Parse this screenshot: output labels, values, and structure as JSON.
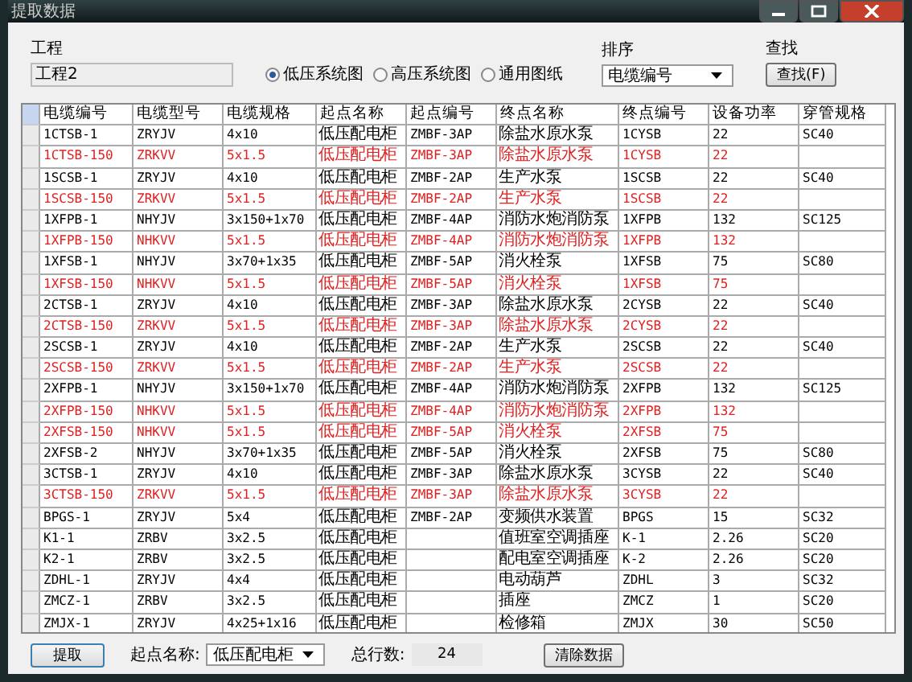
{
  "window": {
    "title": "提取数据"
  },
  "project": {
    "label": "工程",
    "value": "工程2"
  },
  "system_options": [
    {
      "label": "低压系统图",
      "selected": true
    },
    {
      "label": "高压系统图",
      "selected": false
    },
    {
      "label": "通用图纸",
      "selected": false
    }
  ],
  "sort": {
    "label": "排序",
    "value": "电缆编号"
  },
  "find": {
    "label": "查找",
    "button": "查找(F)"
  },
  "table": {
    "columns": [
      "电缆编号",
      "电缆型号",
      "电缆规格",
      "起点名称",
      "起点编号",
      "终点名称",
      "终点编号",
      "设备功率",
      "穿管规格"
    ],
    "rows": [
      {
        "highlighted": false,
        "cells": [
          "1CTSB-1",
          "ZRYJV",
          "4x10",
          "低压配电柜",
          "ZMBF-3AP",
          "除盐水原水泵",
          "1CYSB",
          "22",
          "SC40"
        ]
      },
      {
        "highlighted": true,
        "cells": [
          "1CTSB-150",
          "ZRKVV",
          "5x1.5",
          "低压配电柜",
          "ZMBF-3AP",
          "除盐水原水泵",
          "1CYSB",
          "22",
          ""
        ]
      },
      {
        "highlighted": false,
        "cells": [
          "1SCSB-1",
          "ZRYJV",
          "4x10",
          "低压配电柜",
          "ZMBF-2AP",
          "生产水泵",
          "1SCSB",
          "22",
          "SC40"
        ]
      },
      {
        "highlighted": true,
        "cells": [
          "1SCSB-150",
          "ZRKVV",
          "5x1.5",
          "低压配电柜",
          "ZMBF-2AP",
          "生产水泵",
          "1SCSB",
          "22",
          ""
        ]
      },
      {
        "highlighted": false,
        "cells": [
          "1XFPB-1",
          "NHYJV",
          "3x150+1x70",
          "低压配电柜",
          "ZMBF-4AP",
          "消防水炮消防泵",
          "1XFPB",
          "132",
          "SC125"
        ]
      },
      {
        "highlighted": true,
        "cells": [
          "1XFPB-150",
          "NHKVV",
          "5x1.5",
          "低压配电柜",
          "ZMBF-4AP",
          "消防水炮消防泵",
          "1XFPB",
          "132",
          ""
        ]
      },
      {
        "highlighted": false,
        "cells": [
          "1XFSB-1",
          "NHYJV",
          "3x70+1x35",
          "低压配电柜",
          "ZMBF-5AP",
          "消火栓泵",
          "1XFSB",
          "75",
          "SC80"
        ]
      },
      {
        "highlighted": true,
        "cells": [
          "1XFSB-150",
          "NHKVV",
          "5x1.5",
          "低压配电柜",
          "ZMBF-5AP",
          "消火栓泵",
          "1XFSB",
          "75",
          ""
        ]
      },
      {
        "highlighted": false,
        "cells": [
          "2CTSB-1",
          "ZRYJV",
          "4x10",
          "低压配电柜",
          "ZMBF-3AP",
          "除盐水原水泵",
          "2CYSB",
          "22",
          "SC40"
        ]
      },
      {
        "highlighted": true,
        "cells": [
          "2CTSB-150",
          "ZRKVV",
          "5x1.5",
          "低压配电柜",
          "ZMBF-3AP",
          "除盐水原水泵",
          "2CYSB",
          "22",
          ""
        ]
      },
      {
        "highlighted": false,
        "cells": [
          "2SCSB-1",
          "ZRYJV",
          "4x10",
          "低压配电柜",
          "ZMBF-2AP",
          "生产水泵",
          "2SCSB",
          "22",
          "SC40"
        ]
      },
      {
        "highlighted": true,
        "cells": [
          "2SCSB-150",
          "ZRKVV",
          "5x1.5",
          "低压配电柜",
          "ZMBF-2AP",
          "生产水泵",
          "2SCSB",
          "22",
          ""
        ]
      },
      {
        "highlighted": false,
        "cells": [
          "2XFPB-1",
          "NHYJV",
          "3x150+1x70",
          "低压配电柜",
          "ZMBF-4AP",
          "消防水炮消防泵",
          "2XFPB",
          "132",
          "SC125"
        ]
      },
      {
        "highlighted": true,
        "cells": [
          "2XFPB-150",
          "NHKVV",
          "5x1.5",
          "低压配电柜",
          "ZMBF-4AP",
          "消防水炮消防泵",
          "2XFPB",
          "132",
          ""
        ]
      },
      {
        "highlighted": true,
        "cells": [
          "2XFSB-150",
          "NHKVV",
          "5x1.5",
          "低压配电柜",
          "ZMBF-5AP",
          "消火栓泵",
          "2XFSB",
          "75",
          ""
        ]
      },
      {
        "highlighted": false,
        "cells": [
          "2XFSB-2",
          "NHYJV",
          "3x70+1x35",
          "低压配电柜",
          "ZMBF-5AP",
          "消火栓泵",
          "2XFSB",
          "75",
          "SC80"
        ]
      },
      {
        "highlighted": false,
        "cells": [
          "3CTSB-1",
          "ZRYJV",
          "4x10",
          "低压配电柜",
          "ZMBF-3AP",
          "除盐水原水泵",
          "3CYSB",
          "22",
          "SC40"
        ]
      },
      {
        "highlighted": true,
        "cells": [
          "3CTSB-150",
          "ZRKVV",
          "5x1.5",
          "低压配电柜",
          "ZMBF-3AP",
          "除盐水原水泵",
          "3CYSB",
          "22",
          ""
        ]
      },
      {
        "highlighted": false,
        "cells": [
          "BPGS-1",
          "ZRYJV",
          "5x4",
          "低压配电柜",
          "ZMBF-2AP",
          "变频供水装置",
          "BPGS",
          "15",
          "SC32"
        ]
      },
      {
        "highlighted": false,
        "cells": [
          "K1-1",
          "ZRBV",
          "3x2.5",
          "低压配电柜",
          "",
          "值班室空调插座",
          "K-1",
          "2.26",
          "SC20"
        ]
      },
      {
        "highlighted": false,
        "cells": [
          "K2-1",
          "ZRBV",
          "3x2.5",
          "低压配电柜",
          "",
          "配电室空调插座",
          "K-2",
          "2.26",
          "SC20"
        ]
      },
      {
        "highlighted": false,
        "cells": [
          "ZDHL-1",
          "ZRYJV",
          "4x4",
          "低压配电柜",
          "",
          "电动葫芦",
          "ZDHL",
          "3",
          "SC32"
        ]
      },
      {
        "highlighted": false,
        "cells": [
          "ZMCZ-1",
          "ZRBV",
          "3x2.5",
          "低压配电柜",
          "",
          "插座",
          "ZMCZ",
          "1",
          "SC20"
        ]
      },
      {
        "highlighted": false,
        "cells": [
          "ZMJX-1",
          "ZRYJV",
          "4x25+1x16",
          "低压配电柜",
          "",
          "检修箱",
          "ZMJX",
          "30",
          "SC50"
        ]
      }
    ]
  },
  "footer": {
    "extract_button": "提取",
    "origin_label": "起点名称:",
    "origin_value": "低压配电柜",
    "total_label": "总行数:",
    "total_value": "24",
    "clear_button": "清除数据"
  }
}
